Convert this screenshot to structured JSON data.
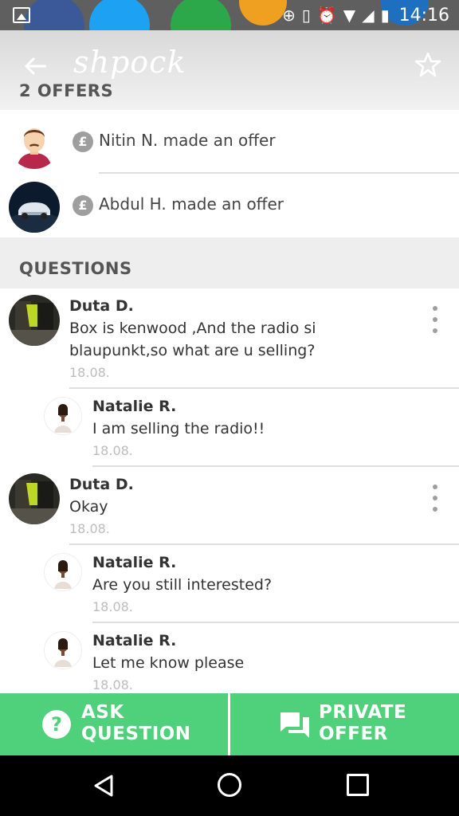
{
  "status_bar": {
    "time": "14:16",
    "icons": [
      "gallery-icon",
      "data-saver-icon",
      "vibrate-icon",
      "alarm-icon",
      "wifi-icon",
      "signal-icon",
      "battery-icon"
    ]
  },
  "app_bar": {
    "logo_text": "shpock",
    "offers_title": "2 OFFERS"
  },
  "offers": [
    {
      "name": "Nitin N.",
      "text": "Nitin N. made an offer"
    },
    {
      "name": "Abdul H.",
      "text": "Abdul H. made an offer"
    }
  ],
  "questions_title": "QUESTIONS",
  "questions": [
    {
      "name": "Duta D.",
      "message": "Box is kenwood ,And the radio si",
      "message2": "blaupunkt,so what are u selling?",
      "date": "18.08."
    },
    {
      "name": "Natalie R.",
      "message": "I am selling the radio!!",
      "date": "18.08."
    },
    {
      "name": "Duta D.",
      "message": "Okay",
      "date": "18.08."
    },
    {
      "name": "Natalie R.",
      "message": "Are you still interested?",
      "date": "18.08."
    },
    {
      "name": "Natalie R.",
      "message": "Let me know please",
      "date": "18.08."
    }
  ],
  "bottom_bar": {
    "ask_line1": "ASK",
    "ask_line2": "QUESTION",
    "offer_line1": "PRIVATE",
    "offer_line2": "OFFER"
  },
  "colors": {
    "accent_green": "#4fd07a",
    "status_bar": "#5f5f5f"
  }
}
